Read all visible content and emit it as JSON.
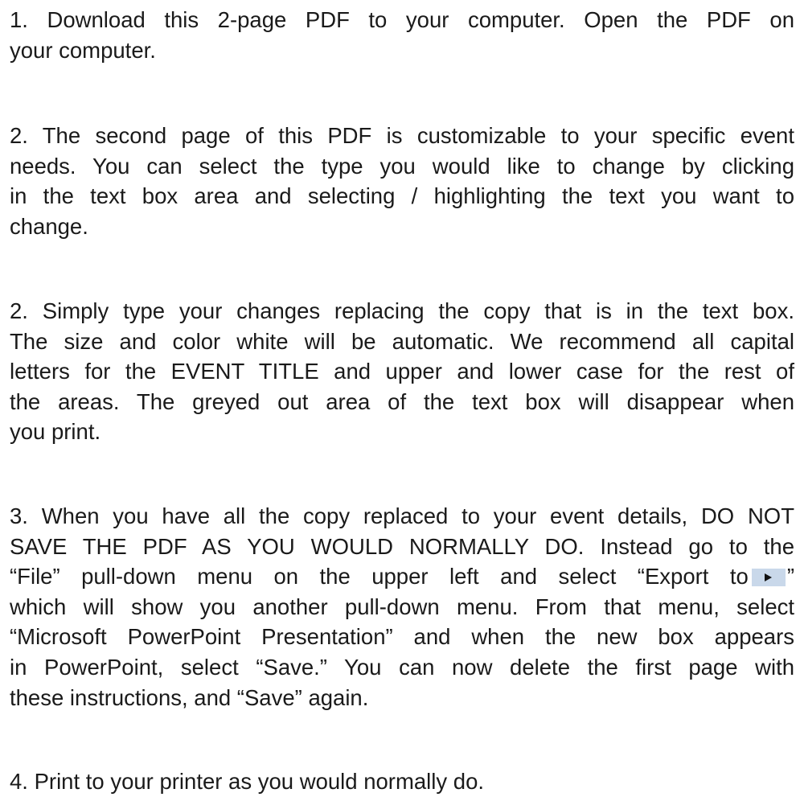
{
  "instructions": {
    "step1": {
      "line1": "1. Download this 2-page PDF to your computer. Open the PDF on",
      "line2": "your computer."
    },
    "step2a": {
      "line1": "2. The second page of this PDF is customizable to your specific event",
      "line2": "needs. You can select the type you would like to change by clicking",
      "line3": "in the text box area and selecting / highlighting the text you want to",
      "line4": "change."
    },
    "step2b": {
      "line1": "2. Simply type your changes replacing the copy that is in the text box.",
      "line2": "The size and color white will be automatic. We recommend all capital",
      "line3": "letters for the EVENT TITLE and upper and lower case for the rest of",
      "line4": "the areas. The greyed out area of the text box will disappear when",
      "line5": "you print."
    },
    "step3": {
      "line1": "3. When you have all the copy replaced to your event details, DO NOT",
      "line2": "SAVE THE PDF AS YOU WOULD NORMALLY DO. Instead go to the",
      "line3_before": "“File” pull-down menu on the upper left and select “Export to",
      "line3_after": "”",
      "line4": "which will show you another pull-down menu. From that menu, select",
      "line5": "“Microsoft PowerPoint Presentation” and when the new box appears",
      "line6": "in PowerPoint, select “Save.”  You can now delete the first page with",
      "line7": "these instructions, and “Save” again."
    },
    "step4": {
      "line1": "4. Print to your printer as you would normally do."
    },
    "export_icon": "play-arrow-icon",
    "export_chip_color": "#c9d8ea"
  }
}
